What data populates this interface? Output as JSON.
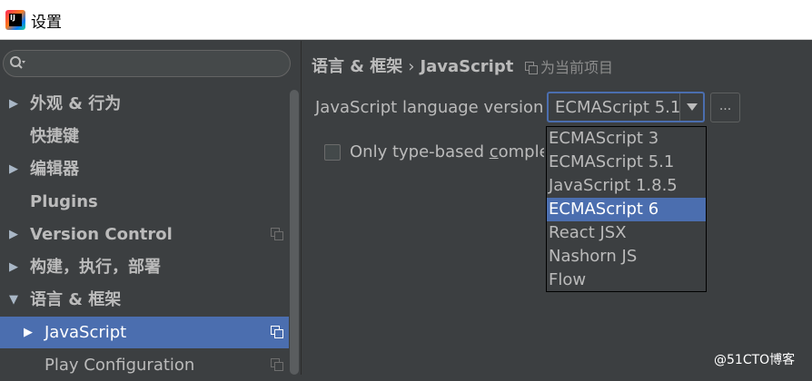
{
  "window": {
    "title": "设置"
  },
  "search": {
    "placeholder": ""
  },
  "sidebar": {
    "items": [
      {
        "label": "外观 & 行为",
        "arrow": "▶",
        "bold": true
      },
      {
        "label": "快捷键",
        "arrow": "",
        "bold": true
      },
      {
        "label": "编辑器",
        "arrow": "▶",
        "bold": true
      },
      {
        "label": "Plugins",
        "arrow": "",
        "bold": true
      },
      {
        "label": "Version Control",
        "arrow": "▶",
        "bold": true
      },
      {
        "label": "构建，执行，部署",
        "arrow": "▶",
        "bold": true
      },
      {
        "label": "语言 & 框架",
        "arrow": "▼",
        "bold": true
      },
      {
        "label": "JavaScript",
        "arrow": "▶",
        "bold": false,
        "selected": true
      },
      {
        "label": "Play Configuration",
        "arrow": "",
        "bold": false
      }
    ]
  },
  "breadcrumb": {
    "parent": "语言 & 框架",
    "separator": "›",
    "current": "JavaScript"
  },
  "scope": {
    "label": "为当前项目"
  },
  "settings": {
    "language_version_label": "JavaScript language version",
    "language_version_value": "ECMAScript 5.1",
    "more_button_label": "...",
    "checkbox_label_prefix": "Only type-based ",
    "checkbox_label_mnemonic": "c",
    "checkbox_label_rest": "omplete",
    "checkbox_checked": false
  },
  "dropdown": {
    "options": [
      "ECMAScript 3",
      "ECMAScript 5.1",
      "JavaScript 1.8.5",
      "ECMAScript 6",
      "React JSX",
      "Nashorn JS",
      "Flow"
    ],
    "highlighted": "ECMAScript 6"
  },
  "watermark": {
    "text": "@51CTO博客"
  },
  "colors": {
    "accent": "#4b6eaf",
    "background": "#3c3f41",
    "text": "#bbbbbb"
  }
}
